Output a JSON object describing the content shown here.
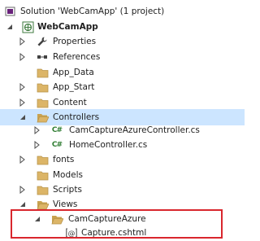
{
  "solution_explorer": {
    "items": [
      {
        "label": "Solution 'WebCamApp' (1 project)",
        "icon": "solution-icon",
        "expander": "none"
      },
      {
        "label": "WebCamApp",
        "icon": "web-project-icon",
        "expander": "expanded"
      },
      {
        "label": "Properties",
        "icon": "wrench-icon",
        "expander": "collapsed"
      },
      {
        "label": "References",
        "icon": "references-icon",
        "expander": "collapsed"
      },
      {
        "label": "App_Data",
        "icon": "folder-icon",
        "expander": "none"
      },
      {
        "label": "App_Start",
        "icon": "folder-icon",
        "expander": "collapsed"
      },
      {
        "label": "Content",
        "icon": "folder-icon",
        "expander": "collapsed"
      },
      {
        "label": "Controllers",
        "icon": "folder-open-icon",
        "expander": "expanded",
        "selected": true
      },
      {
        "label": "CamCaptureAzureController.cs",
        "icon": "csharp-file-icon",
        "expander": "collapsed"
      },
      {
        "label": "HomeController.cs",
        "icon": "csharp-file-icon",
        "expander": "collapsed"
      },
      {
        "label": "fonts",
        "icon": "folder-icon",
        "expander": "collapsed"
      },
      {
        "label": "Models",
        "icon": "folder-icon",
        "expander": "none"
      },
      {
        "label": "Scripts",
        "icon": "folder-icon",
        "expander": "collapsed"
      },
      {
        "label": "Views",
        "icon": "folder-open-icon",
        "expander": "expanded"
      },
      {
        "label": "CamCaptureAzure",
        "icon": "folder-open-icon",
        "expander": "expanded"
      },
      {
        "label": "Capture.cshtml",
        "icon": "razor-file-icon",
        "expander": "none"
      }
    ]
  },
  "colors": {
    "selection": "#cce5ff",
    "highlight_border": "#d9272e",
    "folder": "#dcb567",
    "csharp": "#2f7d32"
  }
}
